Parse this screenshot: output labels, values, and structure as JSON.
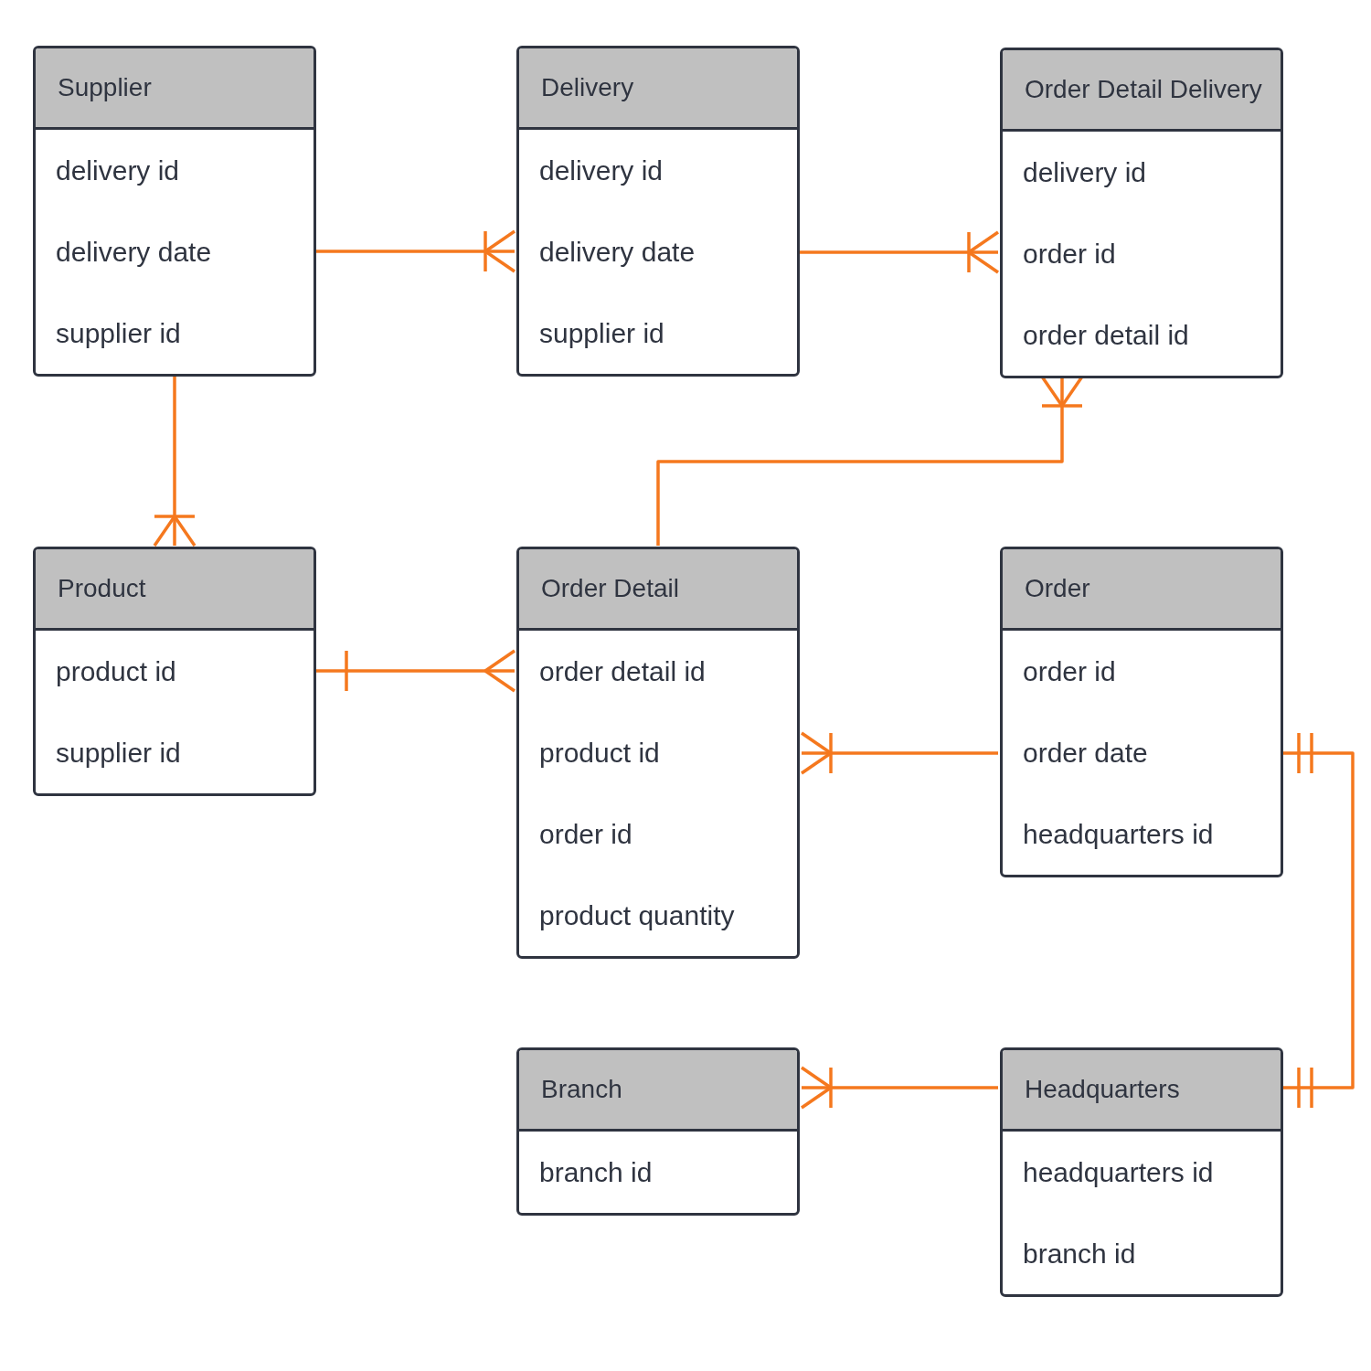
{
  "entities": [
    {
      "name": "Supplier",
      "attributes": [
        "delivery id",
        "delivery date",
        "supplier id"
      ]
    },
    {
      "name": "Delivery",
      "attributes": [
        "delivery id",
        "delivery date",
        "supplier id"
      ]
    },
    {
      "name": "Order Detail Delivery",
      "attributes": [
        "delivery id",
        "order id",
        "order detail id"
      ]
    },
    {
      "name": "Product",
      "attributes": [
        "product id",
        "supplier id"
      ]
    },
    {
      "name": "Order Detail",
      "attributes": [
        "order detail id",
        "product id",
        "order id",
        "product quantity"
      ]
    },
    {
      "name": "Order",
      "attributes": [
        "order id",
        "order date",
        "headquarters id"
      ]
    },
    {
      "name": "Branch",
      "attributes": [
        "branch id"
      ]
    },
    {
      "name": "Headquarters",
      "attributes": [
        "headquarters id",
        "branch id"
      ]
    }
  ],
  "relationships": [
    {
      "end": {
        "kind": "onemany"
      }
    },
    {
      "end": {
        "kind": "onemany"
      }
    },
    {
      "end": {
        "kind": "onemany"
      }
    },
    {
      "end": {
        "kind": "onemany"
      }
    },
    {
      "start": {
        "kind": "one"
      },
      "end": {
        "kind": "many"
      }
    },
    {
      "end": {
        "kind": "onemany"
      }
    },
    {
      "start": {
        "kind": "onlyone"
      },
      "end": {
        "kind": "onlyone"
      }
    },
    {
      "end": {
        "kind": "onemany"
      }
    }
  ]
}
